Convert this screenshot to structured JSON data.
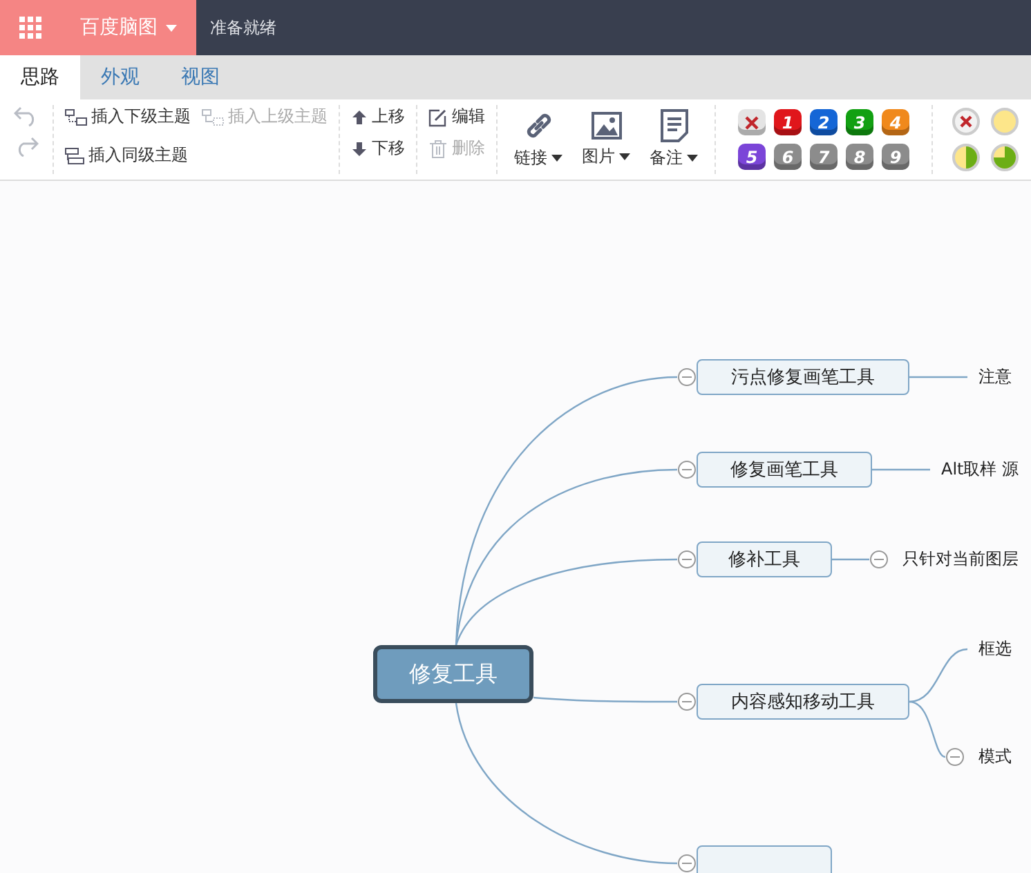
{
  "app_bar": {
    "app_name": "百度脑图",
    "status": "准备就绪"
  },
  "tabs": [
    {
      "label": "思路",
      "selected": true
    },
    {
      "label": "外观",
      "selected": false
    },
    {
      "label": "视图",
      "selected": false
    }
  ],
  "history": [
    {
      "kind": "undo",
      "disabled": true
    },
    {
      "kind": "redo",
      "disabled": true
    }
  ],
  "topic_actions": [
    {
      "kind": "child",
      "label": "插入下级主题",
      "disabled": false
    },
    {
      "kind": "sibling",
      "label": "插入同级主题",
      "disabled": false
    },
    {
      "kind": "parent",
      "label": "插入上级主题",
      "disabled": true
    }
  ],
  "move_actions": [
    {
      "kind": "up",
      "label": "上移"
    },
    {
      "kind": "down",
      "label": "下移"
    }
  ],
  "edit_actions": [
    {
      "kind": "edit",
      "label": "编辑",
      "disabled": false
    },
    {
      "kind": "delete",
      "label": "删除",
      "disabled": true
    }
  ],
  "insert_menus": [
    {
      "kind": "link",
      "label": "链接"
    },
    {
      "kind": "image",
      "label": "图片"
    },
    {
      "kind": "note",
      "label": "备注"
    }
  ],
  "priorities": [
    {
      "kind": "clear"
    },
    {
      "kind": "number",
      "label": "1",
      "color": "#e0161b"
    },
    {
      "kind": "number",
      "label": "2",
      "color": "#1566d6"
    },
    {
      "kind": "number",
      "label": "3",
      "color": "#12a012"
    },
    {
      "kind": "number",
      "label": "4",
      "color": "#f0891c"
    },
    {
      "kind": "number",
      "label": "5",
      "color": "#7b45d8"
    },
    {
      "kind": "number",
      "label": "6",
      "color": "#8c8c8c"
    },
    {
      "kind": "number",
      "label": "7",
      "color": "#8c8c8c"
    },
    {
      "kind": "number",
      "label": "8",
      "color": "#8c8c8c"
    },
    {
      "kind": "number",
      "label": "9",
      "color": "#8c8c8c"
    }
  ],
  "progress": [
    {
      "kind": "clear"
    },
    {
      "kind": "empty"
    },
    {
      "kind": "half"
    },
    {
      "kind": "three_quarters"
    }
  ],
  "mind_map": {
    "root": {
      "text": "修复工具",
      "children": [
        {
          "text": "污点修复画笔工具",
          "expanded": true,
          "children": [
            {
              "text": "注意"
            }
          ]
        },
        {
          "text": "修复画笔工具",
          "expanded": true,
          "children": [
            {
              "text": "Alt取样 源"
            }
          ]
        },
        {
          "text": "修补工具",
          "expanded": true,
          "children": [
            {
              "text": "只针对当前图层",
              "expanded": true
            }
          ]
        },
        {
          "text": "内容感知移动工具",
          "expanded": true,
          "children": [
            {
              "text": "框选"
            },
            {
              "text": "模式",
              "expanded": true
            }
          ]
        },
        {
          "expanded": true
        }
      ]
    }
  }
}
